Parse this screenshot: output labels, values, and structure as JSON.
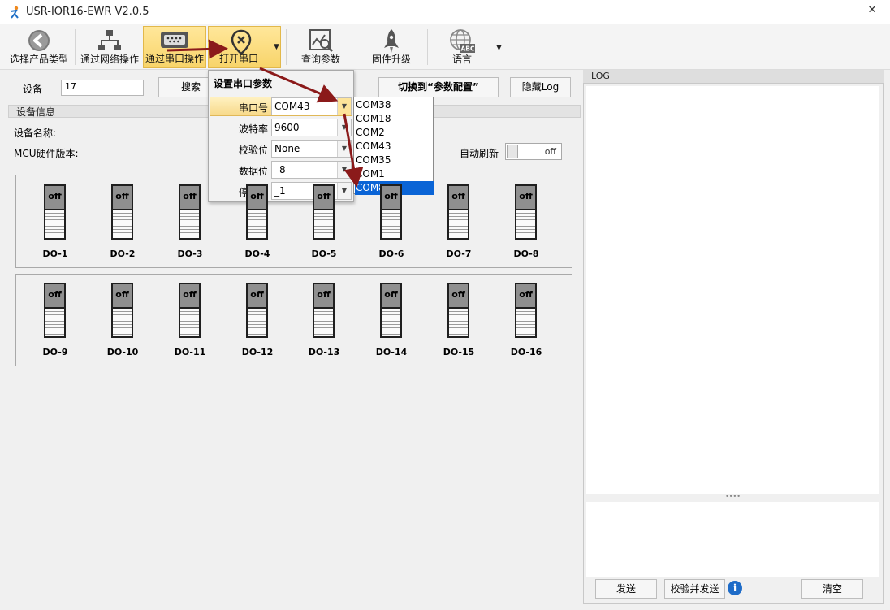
{
  "window": {
    "title": "USR-IOR16-EWR V2.0.5",
    "minimize": "—",
    "close": "✕"
  },
  "toolbar": {
    "select_product": "选择产品类型",
    "via_network": "通过网络操作",
    "via_serial": "通过串口操作",
    "open_serial": "打开串口",
    "query_params": "查询参数",
    "firmware_upgrade": "固件升级",
    "language": "语言",
    "language_icon_text": "ABC"
  },
  "search": {
    "device_label": "设备",
    "device_value": "17",
    "search_button": "搜索",
    "switch_button": "切换到“参数配置”",
    "hide_log_button": "隐藏Log"
  },
  "device_info": {
    "section_title": "设备信息",
    "name_label": "设备名称:",
    "mcu_label": "MCU硬件版本:",
    "auto_refresh_label": "自动刷新",
    "auto_refresh_state": "off"
  },
  "outputs": [
    {
      "label": "DO-1",
      "state": "off"
    },
    {
      "label": "DO-2",
      "state": "off"
    },
    {
      "label": "DO-3",
      "state": "off"
    },
    {
      "label": "DO-4",
      "state": "off"
    },
    {
      "label": "DO-5",
      "state": "off"
    },
    {
      "label": "DO-6",
      "state": "off"
    },
    {
      "label": "DO-7",
      "state": "off"
    },
    {
      "label": "DO-8",
      "state": "off"
    },
    {
      "label": "DO-9",
      "state": "off"
    },
    {
      "label": "DO-10",
      "state": "off"
    },
    {
      "label": "DO-11",
      "state": "off"
    },
    {
      "label": "DO-12",
      "state": "off"
    },
    {
      "label": "DO-13",
      "state": "off"
    },
    {
      "label": "DO-14",
      "state": "off"
    },
    {
      "label": "DO-15",
      "state": "off"
    },
    {
      "label": "DO-16",
      "state": "off"
    }
  ],
  "serial_popup": {
    "title": "设置串口参数",
    "port_label": "串口号",
    "port_value": "COM43",
    "baud_label": "波特率",
    "baud_value": "9600",
    "parity_label": "校验位",
    "parity_value": "None",
    "databits_label": "数据位",
    "databits_value": "_8",
    "stopbits_label": "停止位",
    "stopbits_value": "_1"
  },
  "com_list": [
    "COM38",
    "COM18",
    "COM2",
    "COM43",
    "COM35",
    "COM1",
    "COM8"
  ],
  "com_list_selected": "COM8",
  "log": {
    "title": "LOG",
    "splitter": "••••",
    "send_button": "发送",
    "verify_send_button": "校验并发送",
    "info_icon": "i",
    "clear_button": "清空"
  },
  "colors": {
    "accent_yellow": "#f8d46a",
    "selection_blue": "#0a64d6",
    "annotation_arrow": "#8b1a1a"
  }
}
